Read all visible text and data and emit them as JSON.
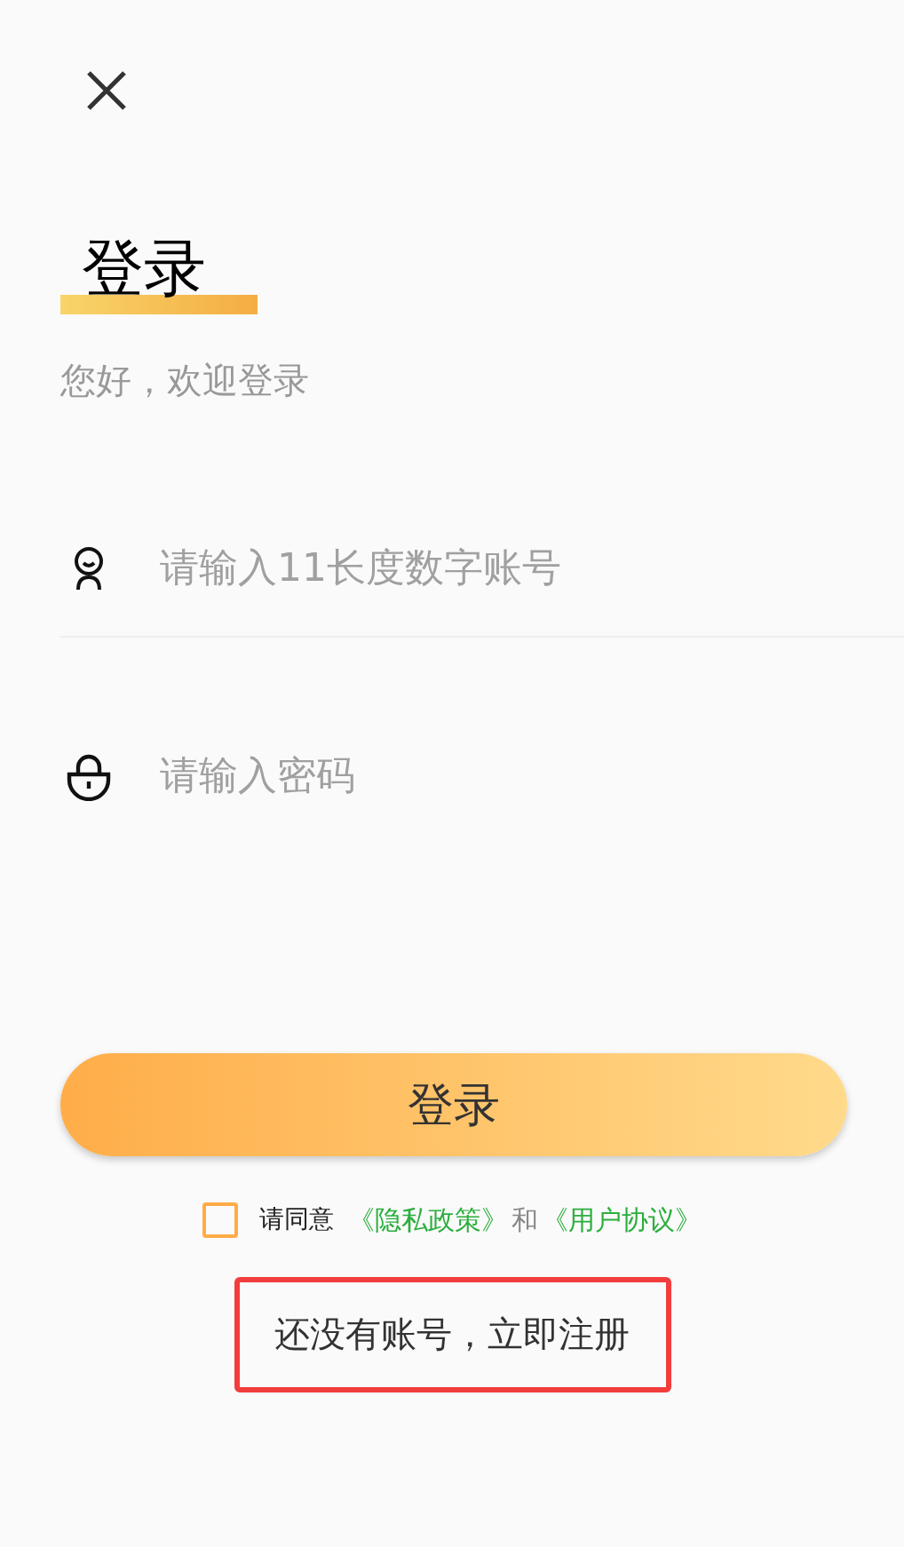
{
  "title": "登录",
  "subtitle": "您好，欢迎登录",
  "fields": [
    {
      "kind": "account",
      "placeholder": "请输入11长度数字账号",
      "divider": true
    },
    {
      "kind": "password",
      "placeholder": "请输入密码",
      "divider": false
    }
  ],
  "login_button": {
    "label": "登录"
  },
  "agreement": {
    "checked": false,
    "prefix": "请同意",
    "links": [
      "《隐私政策》",
      "《用户协议》"
    ],
    "conjunction": "和"
  },
  "register_link": {
    "text": "还没有账号，立即注册",
    "highlighted": true
  }
}
